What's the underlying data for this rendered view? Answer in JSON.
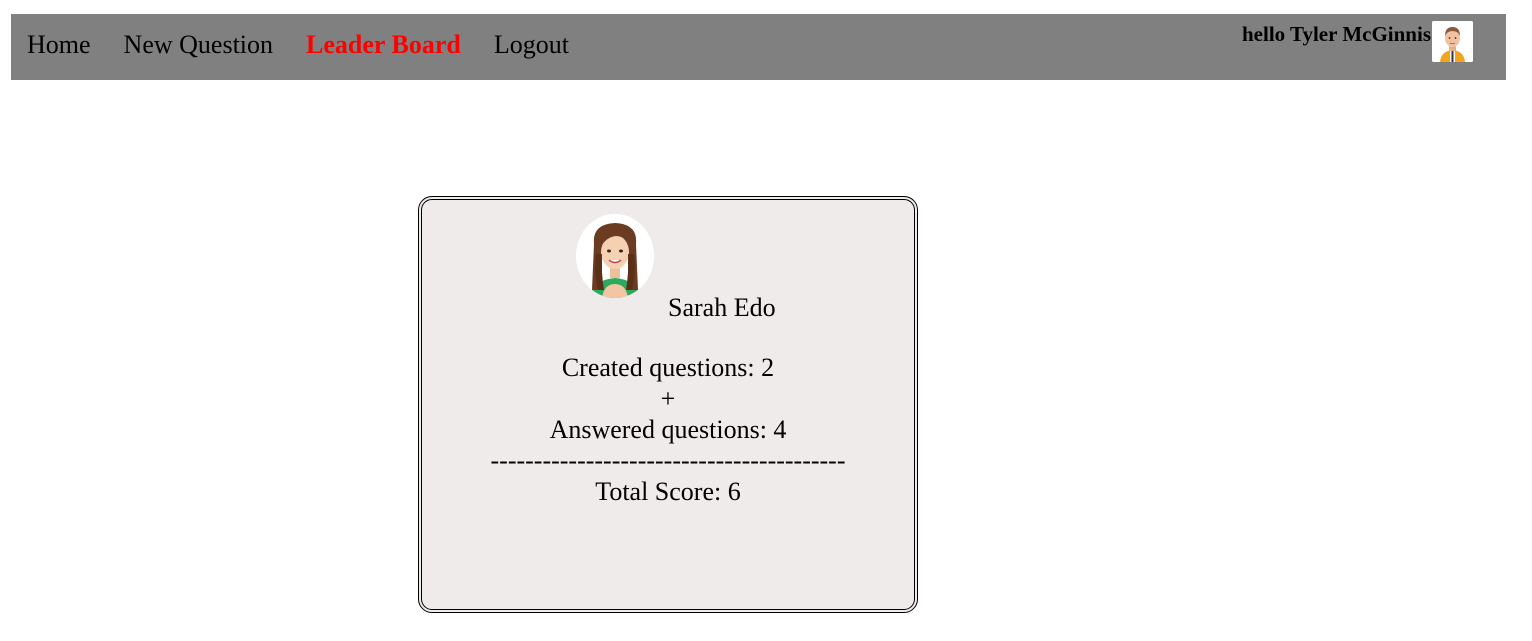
{
  "nav": {
    "items": [
      {
        "label": "Home",
        "active": false
      },
      {
        "label": "New Question",
        "active": false
      },
      {
        "label": "Leader Board",
        "active": true
      },
      {
        "label": "Logout",
        "active": false
      }
    ],
    "greeting": "hello Tyler McGinnis",
    "avatar_icon": "male-avatar-icon"
  },
  "card": {
    "avatar_icon": "female-avatar-icon",
    "name": "Sarah Edo",
    "created": "Created questions: 2",
    "plus": "+",
    "answered": "Answered questions: 4",
    "divider": "-----------------------------------------",
    "total": "Total Score: 6"
  },
  "colors": {
    "navbar_bg": "#808080",
    "active_link": "#ff0000",
    "card_bg": "#efebea"
  }
}
